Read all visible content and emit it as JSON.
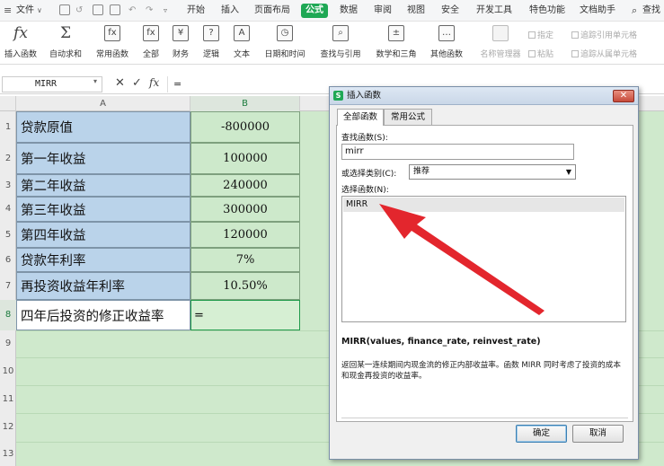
{
  "menubar": {
    "file": "文件",
    "items": [
      "开始",
      "插入",
      "页面布局",
      "公式",
      "数据",
      "审阅",
      "视图",
      "安全",
      "开发工具",
      "特色功能",
      "文档助手"
    ],
    "active": "公式",
    "search": "查找"
  },
  "ribbon": {
    "buttons": [
      {
        "label": "插入函数",
        "icon": "fx"
      },
      {
        "label": "自动求和",
        "icon": "Σ"
      },
      {
        "label": "常用函数",
        "icon": "fx"
      },
      {
        "label": "全部",
        "icon": "fx"
      },
      {
        "label": "财务",
        "icon": "¥"
      },
      {
        "label": "逻辑",
        "icon": "?"
      },
      {
        "label": "文本",
        "icon": "A"
      },
      {
        "label": "日期和时间",
        "icon": "◷"
      },
      {
        "label": "查找与引用",
        "icon": "⌕"
      },
      {
        "label": "数学和三角",
        "icon": "±"
      },
      {
        "label": "其他函数",
        "icon": "…"
      }
    ],
    "disabled": [
      "名称管理器",
      "指定",
      "粘贴",
      "追踪引用单元格",
      "追踪从属单元格"
    ]
  },
  "formula_bar": {
    "name_box": "MIRR",
    "content": "="
  },
  "sheet": {
    "columns": [
      "A",
      "B"
    ],
    "row_numbers": [
      "1",
      "2",
      "3",
      "4",
      "5",
      "6",
      "7",
      "8",
      "9",
      "10",
      "11",
      "12",
      "13"
    ],
    "rows": [
      {
        "label": "贷款原值",
        "value": "-800000"
      },
      {
        "label": "第一年收益",
        "value": "100000"
      },
      {
        "label": "第二年收益",
        "value": "240000"
      },
      {
        "label": "第三年收益",
        "value": "300000"
      },
      {
        "label": "第四年收益",
        "value": "120000"
      },
      {
        "label": "贷款年利率",
        "value": "7%"
      },
      {
        "label": "再投资收益年利率",
        "value": "10.50%"
      },
      {
        "label": "四年后投资的修正收益率",
        "value": "="
      }
    ]
  },
  "dialog": {
    "title": "插入函数",
    "tabs": [
      "全部函数",
      "常用公式"
    ],
    "search_label": "查找函数(S):",
    "search_value": "mirr",
    "category_label": "或选择类别(C):",
    "category_value": "推荐",
    "list_label": "选择函数(N):",
    "functions": [
      "MIRR"
    ],
    "signature": "MIRR(values, finance_rate, reinvest_rate)",
    "description": "返回某一连续期间内现金流的修正内部收益率。函数 MIRR 同时考虑了投资的成本和现金再投资的收益率。",
    "ok": "确定",
    "cancel": "取消"
  },
  "colors": {
    "accent": "#1fa855",
    "label_fill": "#bad3ea",
    "value_fill": "#cde9cb",
    "arrow": "#e3262d"
  }
}
